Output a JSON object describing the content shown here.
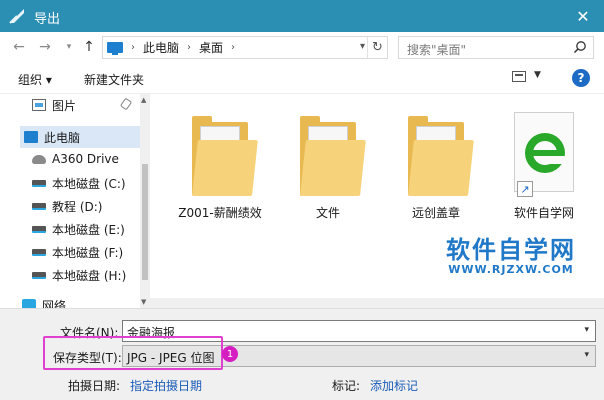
{
  "window": {
    "title": "导出",
    "close_glyph": "✕"
  },
  "address": {
    "path": [
      "此电脑",
      "桌面"
    ],
    "search_placeholder": "搜索\"桌面\""
  },
  "toolbar": {
    "organize": "组织 ▾",
    "new_folder": "新建文件夹",
    "help": "?"
  },
  "sidebar": {
    "items": [
      {
        "label": "图片"
      },
      {
        "label": "此电脑"
      },
      {
        "label": "A360 Drive"
      },
      {
        "label": "本地磁盘 (C:)"
      },
      {
        "label": "教程 (D:)"
      },
      {
        "label": "本地磁盘 (E:)"
      },
      {
        "label": "本地磁盘 (F:)"
      },
      {
        "label": "本地磁盘 (H:)"
      },
      {
        "label": "网络"
      }
    ]
  },
  "files": [
    {
      "label": "Z001-薪酬绩效",
      "icon": "folder-icon"
    },
    {
      "label": "文件",
      "icon": "folder-icon"
    },
    {
      "label": "远创盖章",
      "icon": "folder-icon"
    },
    {
      "label": "软件自学网",
      "icon": "ie-shortcut-icon"
    }
  ],
  "watermark": {
    "title": "软件自学网",
    "url": "WWW.RJZXW.COM"
  },
  "form": {
    "filename_label": "文件名(N):",
    "filename_value": "金融海报",
    "filetype_label": "保存类型(T):",
    "filetype_value": "JPG - JPEG 位图",
    "date_label": "拍摄日期:",
    "date_link": "指定拍摄日期",
    "tags_label": "标记:",
    "tags_link": "添加标记"
  },
  "annotation": {
    "badge": "1"
  },
  "colors": {
    "titlebar": "#2b8eb3",
    "highlight": "#e040d0",
    "badge": "#d51fc0",
    "watermark": "#1f78c8"
  }
}
